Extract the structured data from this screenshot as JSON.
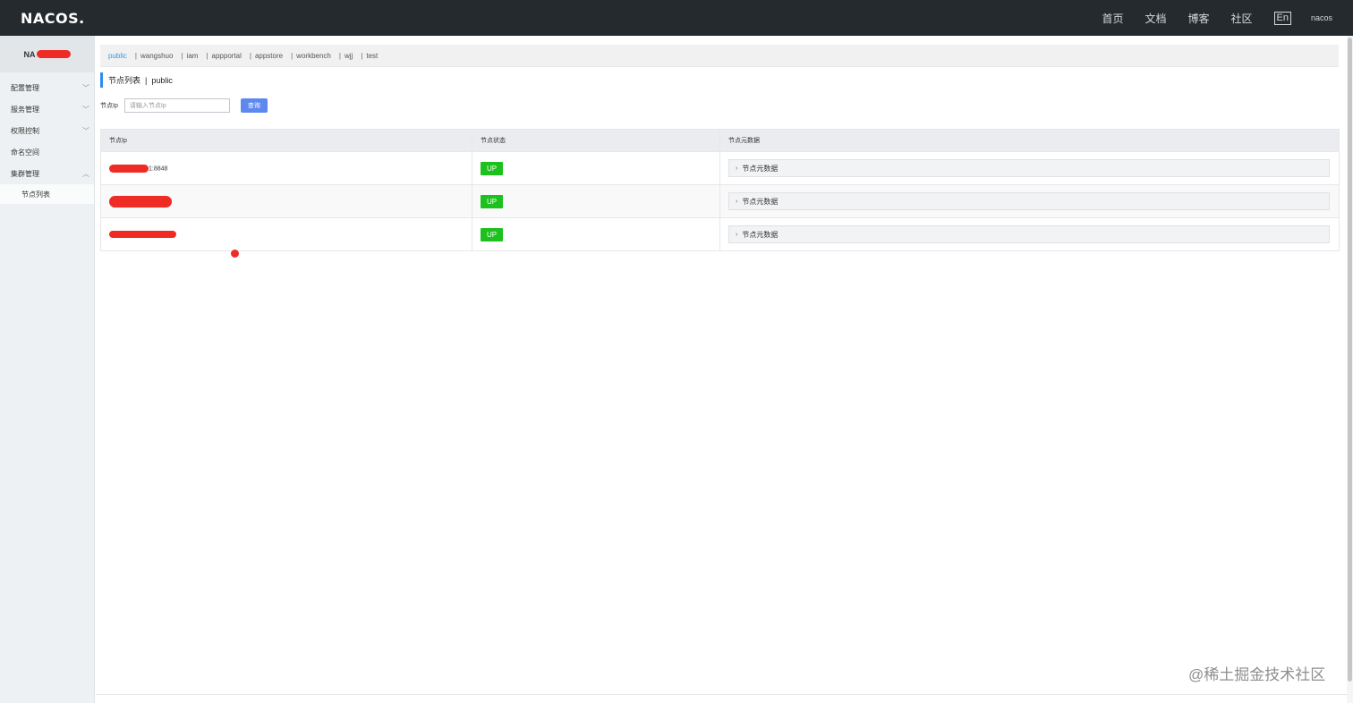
{
  "header": {
    "logo": "NACOS.",
    "nav": [
      "首页",
      "文档",
      "博客",
      "社区"
    ],
    "lang": "En",
    "user": "nacos"
  },
  "sidebar": {
    "title": "NA",
    "menu": [
      {
        "label": "配置管理",
        "chevron": "chevron-down-icon"
      },
      {
        "label": "服务管理",
        "chevron": "chevron-down-icon"
      },
      {
        "label": "权限控制",
        "chevron": "chevron-down-icon"
      },
      {
        "label": "命名空间",
        "chevron": ""
      },
      {
        "label": "集群管理",
        "chevron": "chevron-up-icon"
      }
    ],
    "submenu": [
      "节点列表"
    ]
  },
  "namespaces": {
    "items": [
      "public",
      "wangshuo",
      "iam",
      "appportal",
      "appstore",
      "workbench",
      "wjj",
      "test"
    ],
    "active": "public",
    "separator": "|"
  },
  "page": {
    "title": "节点列表",
    "namespace": "public",
    "separator": "|"
  },
  "search": {
    "label": "节点Ip",
    "placeholder": "请输入节点Ip",
    "button": "查询"
  },
  "table": {
    "headers": [
      "节点Ip",
      "节点状态",
      "节点元数据"
    ],
    "rows": [
      {
        "ip_suffix": "1:8848",
        "status": "UP",
        "meta": "节点元数据"
      },
      {
        "ip_suffix": "",
        "status": "UP",
        "meta": "节点元数据"
      },
      {
        "ip_suffix": "",
        "status": "UP",
        "meta": "节点元数据"
      }
    ]
  },
  "watermark": "@稀土掘金技术社区",
  "colors": {
    "header_bg": "#252a2f",
    "sidebar_bg": "#eef1f3",
    "accent": "#2d9be8",
    "button": "#5d89ef",
    "up_badge": "#1dc11d",
    "redaction": "#ee2b24"
  }
}
